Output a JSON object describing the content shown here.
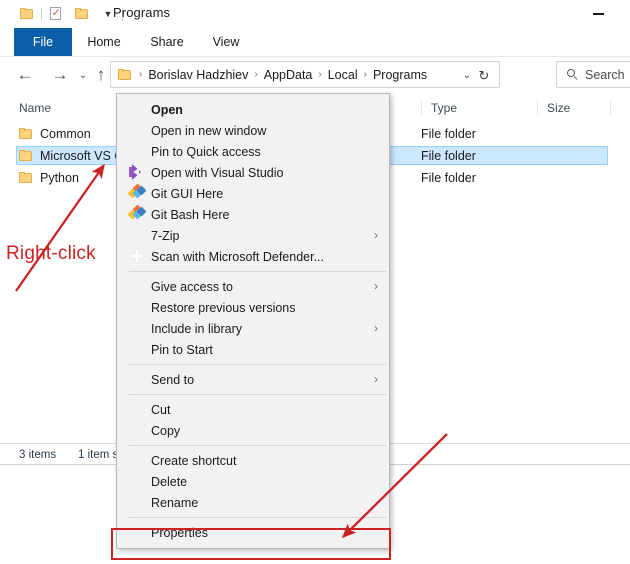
{
  "window": {
    "title": "Programs",
    "minimize_label": "—",
    "quick_access": [
      {
        "name": "folder-icon",
        "label": "Folder"
      },
      {
        "name": "properties-icon",
        "label": "Properties"
      },
      {
        "name": "new-folder-icon",
        "label": "New folder"
      },
      {
        "name": "customize-caret-icon",
        "label": "▾"
      }
    ]
  },
  "ribbon": {
    "tabs": [
      {
        "id": "file",
        "label": "File",
        "active": true
      },
      {
        "id": "home",
        "label": "Home",
        "active": false
      },
      {
        "id": "share",
        "label": "Share",
        "active": false
      },
      {
        "id": "view",
        "label": "View",
        "active": false
      }
    ]
  },
  "navigation": {
    "back_icon": "←",
    "forward_icon": "→",
    "recent_icon": "⌄",
    "up_icon": "↑",
    "breadcrumbs": [
      "Borislav Hadzhiev",
      "AppData",
      "Local",
      "Programs"
    ],
    "separator": "›",
    "dropdown_icon": "⌄",
    "refresh_icon": "↻"
  },
  "search": {
    "placeholder": "Search",
    "icon": "search-icon"
  },
  "file_pane": {
    "columns": [
      "Name",
      "Type",
      "Size"
    ],
    "rows": [
      {
        "name": "Common",
        "type": "File folder",
        "size": "",
        "selected": false
      },
      {
        "name": "Microsoft VS C",
        "type": "File folder",
        "size": "",
        "selected": true
      },
      {
        "name": "Python",
        "type": "File folder",
        "size": "",
        "selected": false
      }
    ]
  },
  "status_bar": {
    "items_count": "3 items",
    "selected_text": "1 item s"
  },
  "context_menu": {
    "groups": [
      [
        {
          "label": "Open",
          "icon": null,
          "bold": true,
          "submenu": false
        },
        {
          "label": "Open in new window",
          "icon": null,
          "bold": false,
          "submenu": false
        },
        {
          "label": "Pin to Quick access",
          "icon": null,
          "bold": false,
          "submenu": false
        },
        {
          "label": "Open with Visual Studio",
          "icon": "visual-studio-icon",
          "bold": false,
          "submenu": false
        },
        {
          "label": "Git GUI Here",
          "icon": "git-icon",
          "bold": false,
          "submenu": false
        },
        {
          "label": "Git Bash Here",
          "icon": "git-icon",
          "bold": false,
          "submenu": false
        },
        {
          "label": "7-Zip",
          "icon": null,
          "bold": false,
          "submenu": true
        },
        {
          "label": "Scan with Microsoft Defender...",
          "icon": "defender-icon",
          "bold": false,
          "submenu": false
        }
      ],
      [
        {
          "label": "Give access to",
          "icon": null,
          "bold": false,
          "submenu": true
        },
        {
          "label": "Restore previous versions",
          "icon": null,
          "bold": false,
          "submenu": false
        },
        {
          "label": "Include in library",
          "icon": null,
          "bold": false,
          "submenu": true
        },
        {
          "label": "Pin to Start",
          "icon": null,
          "bold": false,
          "submenu": false
        }
      ],
      [
        {
          "label": "Send to",
          "icon": null,
          "bold": false,
          "submenu": true
        }
      ],
      [
        {
          "label": "Cut",
          "icon": null,
          "bold": false,
          "submenu": false
        },
        {
          "label": "Copy",
          "icon": null,
          "bold": false,
          "submenu": false
        }
      ],
      [
        {
          "label": "Create shortcut",
          "icon": null,
          "bold": false,
          "submenu": false
        },
        {
          "label": "Delete",
          "icon": null,
          "bold": false,
          "submenu": false
        },
        {
          "label": "Rename",
          "icon": null,
          "bold": false,
          "submenu": false
        }
      ],
      [
        {
          "label": "Properties",
          "icon": null,
          "bold": false,
          "submenu": false
        }
      ]
    ],
    "submenu_icon": "›"
  },
  "annotations": {
    "right_click_label": "Right-click",
    "accent_color": "#cc2222",
    "highlight_target": "Properties"
  },
  "colors": {
    "accent_blue": "#0b5ea8",
    "selection_blue": "#cce8ff",
    "menu_bg": "#f2f2f2",
    "annotation_red": "#cc2222",
    "folder_yellow": "#fbd37a"
  }
}
